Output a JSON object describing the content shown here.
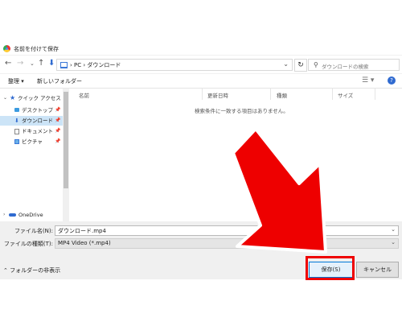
{
  "window": {
    "title": "名前を付けて保存"
  },
  "address": {
    "crumbs": "›  PC  ›  ダウンロード",
    "search_placeholder": "ダウンロードの検索"
  },
  "toolbar": {
    "organize": "整理 ▾",
    "new_folder": "新しいフォルダー"
  },
  "nav": {
    "quick_access": "クイック アクセス",
    "items": [
      {
        "label": "デスクトップ"
      },
      {
        "label": "ダウンロード"
      },
      {
        "label": "ドキュメント"
      },
      {
        "label": "ピクチャ"
      }
    ],
    "onedrive": "OneDrive"
  },
  "columns": {
    "name": "名前",
    "modified": "更新日時",
    "type": "種類",
    "size": "サイズ"
  },
  "empty_message": "検索条件に一致する項目はありません。",
  "footer": {
    "filename_label": "ファイル名(N):",
    "filename_value": "ダウンロード.mp4",
    "filetype_label": "ファイルの種類(T):",
    "filetype_value": "MP4 Video (*.mp4)",
    "hide_folders": "フォルダーの非表示",
    "save_label": "保存(S)",
    "cancel_label": "キャンセル"
  },
  "colors": {
    "accent": "#0078d7",
    "highlight": "#e00000",
    "arrow": "#ee0000"
  }
}
